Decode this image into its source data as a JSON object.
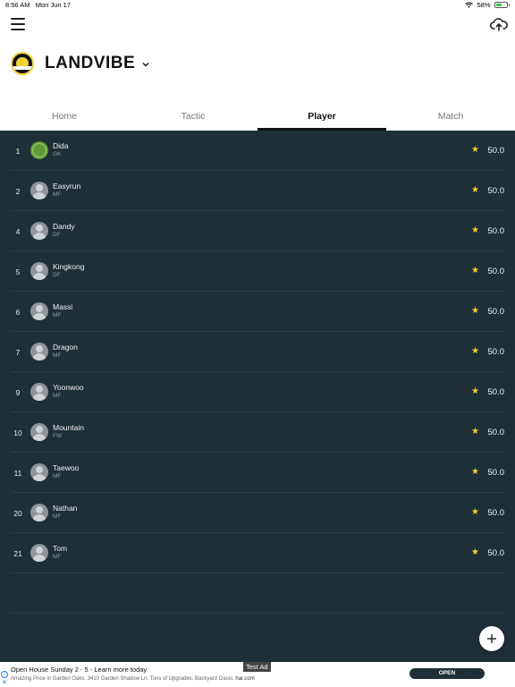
{
  "status_bar": {
    "time": "8:56 AM",
    "date": "Mon Jun 17",
    "battery": "58%",
    "battery_level": 0.58
  },
  "header": {
    "menu_icon": "hamburger-menu-icon",
    "upload_icon": "cloud-upload-icon",
    "team_name": "LANDVIBE",
    "team_dropdown_icon": "chevron-down-icon"
  },
  "tabs": [
    {
      "label": "Home",
      "active": false
    },
    {
      "label": "Tactic",
      "active": false
    },
    {
      "label": "Player",
      "active": true
    },
    {
      "label": "Match",
      "active": false
    }
  ],
  "players": [
    {
      "number": "1",
      "name": "Dida",
      "position": "GK",
      "rating": "50.0",
      "avatar": "pitch"
    },
    {
      "number": "2",
      "name": "Easyrun",
      "position": "MF",
      "rating": "50.0",
      "avatar": "default"
    },
    {
      "number": "4",
      "name": "Dandy",
      "position": "DF",
      "rating": "50.0",
      "avatar": "default"
    },
    {
      "number": "5",
      "name": "Kingkong",
      "position": "DF",
      "rating": "50.0",
      "avatar": "default"
    },
    {
      "number": "6",
      "name": "Massi",
      "position": "MF",
      "rating": "50.0",
      "avatar": "default"
    },
    {
      "number": "7",
      "name": "Dragon",
      "position": "MF",
      "rating": "50.0",
      "avatar": "default"
    },
    {
      "number": "9",
      "name": "Yoonwoo",
      "position": "MF",
      "rating": "50.0",
      "avatar": "default"
    },
    {
      "number": "10",
      "name": "Mountain",
      "position": "FW",
      "rating": "50.0",
      "avatar": "default"
    },
    {
      "number": "11",
      "name": "Taewoo",
      "position": "MF",
      "rating": "50.0",
      "avatar": "default"
    },
    {
      "number": "20",
      "name": "Nathan",
      "position": "MF",
      "rating": "50.0",
      "avatar": "default"
    },
    {
      "number": "21",
      "name": "Tom",
      "position": "MF",
      "rating": "50.0",
      "avatar": "default"
    }
  ],
  "fab_icon": "plus-icon",
  "ad": {
    "label": "Test Ad",
    "headline": "Open House Sunday 2 - 5 - Learn more today",
    "body": "Amazing Price in Garden Oaks. 3410 Garden Shadow Ln. Tons of Upgrades, Backyard Oasis.",
    "domain": "har.com",
    "cta": "OPEN"
  },
  "colors": {
    "list_background": "#1f2f37",
    "star": "#f5d12a",
    "team_logo_accent": "#f3d23a"
  }
}
